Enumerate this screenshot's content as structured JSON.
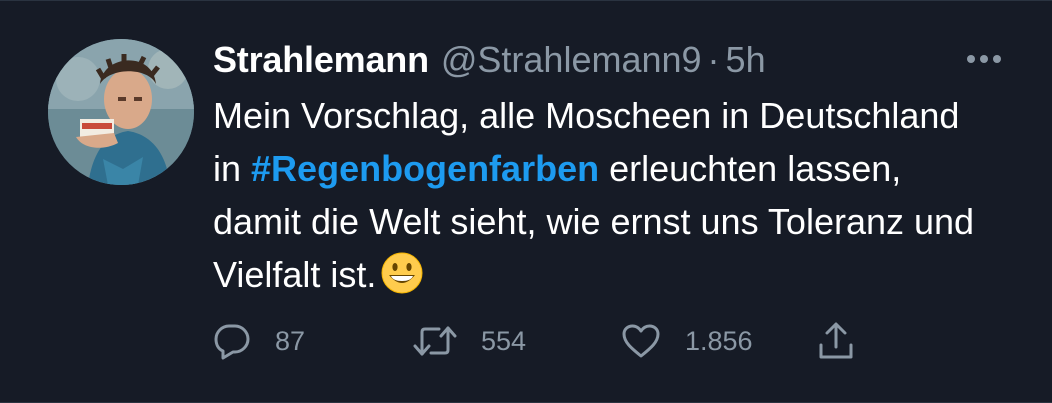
{
  "tweet": {
    "display_name": "Strahlemann",
    "handle": "@Strahlemann9",
    "separator": "·",
    "time": "5h",
    "text_part1": "Mein Vorschlag, alle Moscheen in Deutschland in ",
    "hashtag": "#Regenbogenfarben",
    "text_part2": " erleuchten lassen, damit die Welt sieht, wie ernst uns Toleranz und Vielfalt ist.",
    "emoji": "grinning-face-icon"
  },
  "actions": {
    "replies": "87",
    "retweets": "554",
    "likes": "1.856"
  },
  "colors": {
    "background": "#161b26",
    "accent": "#1d9bf0",
    "muted": "#8b98a5",
    "text": "#ffffff"
  }
}
